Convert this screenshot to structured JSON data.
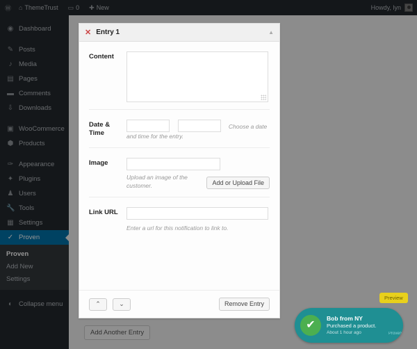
{
  "adminbar": {
    "wp_logo_icon": "wordpress-logo-icon",
    "site_name": "ThemeTrust",
    "home_icon": "home-icon",
    "comments_icon": "comment-bubble-icon",
    "comments_count": "0",
    "new_icon": "plus-icon",
    "new_label": "New",
    "howdy": "Howdy, lyn",
    "avatar_icon": "user-avatar-icon"
  },
  "sidebar": {
    "items": [
      {
        "label": "Dashboard",
        "icon": "dashboard-icon",
        "glyph": "◉"
      },
      {
        "label": "Posts",
        "icon": "pin-icon",
        "glyph": "✎"
      },
      {
        "label": "Media",
        "icon": "media-icon",
        "glyph": "♪"
      },
      {
        "label": "Pages",
        "icon": "page-icon",
        "glyph": "▤"
      },
      {
        "label": "Comments",
        "icon": "comment-icon",
        "glyph": "▬"
      },
      {
        "label": "Downloads",
        "icon": "download-icon",
        "glyph": "⇩"
      },
      {
        "label": "WooCommerce",
        "icon": "woocommerce-icon",
        "glyph": "▣"
      },
      {
        "label": "Products",
        "icon": "products-icon",
        "glyph": "⬢"
      },
      {
        "label": "Appearance",
        "icon": "paintbrush-icon",
        "glyph": "✑"
      },
      {
        "label": "Plugins",
        "icon": "plugin-icon",
        "glyph": "✦"
      },
      {
        "label": "Users",
        "icon": "users-icon",
        "glyph": "♟"
      },
      {
        "label": "Tools",
        "icon": "tools-icon",
        "glyph": "🔧"
      },
      {
        "label": "Settings",
        "icon": "settings-icon",
        "glyph": "▦"
      },
      {
        "label": "Proven",
        "icon": "check-icon",
        "glyph": "✓"
      }
    ],
    "submenu": [
      {
        "label": "Proven",
        "active": true
      },
      {
        "label": "Add New",
        "active": false
      },
      {
        "label": "Settings",
        "active": false
      }
    ],
    "collapse": {
      "label": "Collapse menu",
      "icon": "collapse-arrow-icon",
      "glyph": "◐"
    },
    "accent_color": "#0073aa",
    "bg_color": "#23282d"
  },
  "page": {
    "add_another_label": "Add Another Entry"
  },
  "panel": {
    "close_icon": "close-x-icon",
    "title": "Entry 1",
    "toggle_icon": "chevron-up-icon",
    "fields": {
      "content": {
        "label": "Content",
        "value": "",
        "placeholder": ""
      },
      "datetime": {
        "label": "Date & Time",
        "date_value": "",
        "time_value": "",
        "hint_inline": "Choose a date",
        "hint_wrap": "and time for the entry."
      },
      "image": {
        "label": "Image",
        "value": "",
        "hint": "Upload an image of the customer.",
        "button_label": "Add or Upload File"
      },
      "link_url": {
        "label": "Link URL",
        "value": "",
        "hint": "Enter a url for this notification to link to."
      }
    },
    "footer": {
      "move_up_icon": "chevron-up-icon",
      "move_up_glyph": "⌃",
      "move_down_icon": "chevron-down-icon",
      "move_down_glyph": "⌄",
      "remove_label": "Remove Entry"
    }
  },
  "notification": {
    "preview_badge": "Preview",
    "check_icon": "checkmark-circle-icon",
    "check_glyph": "✔",
    "name": "Bob from NY",
    "message": "Purchased a product.",
    "time": "About 1 hour ago",
    "brand": "Proven",
    "bg_color": "#1f8f93",
    "check_color": "#4caf50",
    "badge_color": "#e8d01c"
  }
}
